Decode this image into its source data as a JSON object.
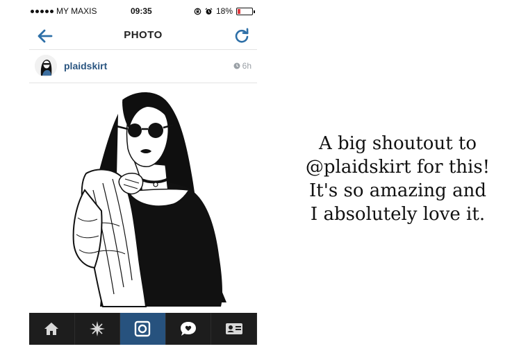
{
  "status_bar": {
    "carrier": "MY MAXIS",
    "time": "09:35",
    "battery_text": "18%",
    "battery_level": 0.18,
    "icons": [
      "signal-dots-icon",
      "rotation-lock-icon",
      "alarm-icon",
      "battery-icon"
    ]
  },
  "nav": {
    "title": "PHOTO",
    "back_icon": "back-arrow-icon",
    "refresh_icon": "refresh-icon"
  },
  "post": {
    "username": "plaidskirt",
    "age": "6h",
    "clock_icon": "clock-icon",
    "image_subject": "black-and-white illustration of a woman with sunglasses and jacket"
  },
  "tab_bar": {
    "tabs": [
      "home-icon",
      "explore-icon",
      "camera-icon",
      "activity-icon",
      "profile-icon"
    ],
    "active_tab": "camera-icon"
  },
  "caption": {
    "lines": [
      "A big shoutout to",
      "@plaidskirt for this!",
      "It's so amazing and",
      "I absolutely love it."
    ]
  },
  "colors": {
    "link_blue": "#2a5580",
    "tab_active": "#27527e",
    "tab_bar_bg": "#1d1d1d",
    "battery_red": "#e0393e",
    "nav_icon_blue": "#2d6fa7"
  }
}
